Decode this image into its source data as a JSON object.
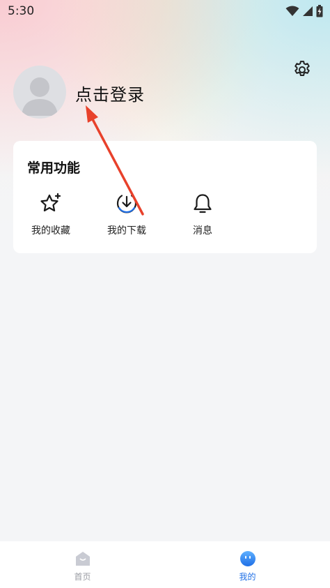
{
  "status_bar": {
    "time": "5:30"
  },
  "profile": {
    "login_label": "点击登录"
  },
  "common_functions": {
    "title": "常用功能",
    "items": [
      {
        "label": "我的收藏",
        "icon": "star-sparkle-icon"
      },
      {
        "label": "我的下载",
        "icon": "download-icon"
      },
      {
        "label": "消息",
        "icon": "bell-icon"
      }
    ]
  },
  "bottom_nav": {
    "items": [
      {
        "label": "首页",
        "icon": "home-icon",
        "active": false
      },
      {
        "label": "我的",
        "icon": "profile-face-icon",
        "active": true
      }
    ]
  },
  "colors": {
    "accent": "#1f6fe6",
    "annotation_arrow": "#e8412b",
    "inactive_nav": "#9a9ca3"
  }
}
